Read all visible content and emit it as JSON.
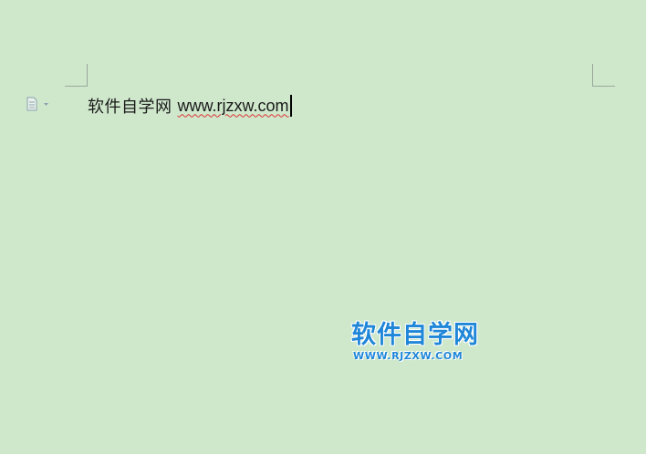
{
  "document": {
    "line_cn": "软件自学网",
    "line_url": "www.rjzxw.com"
  },
  "watermark": {
    "title": "软件自学网",
    "url": "WWW.RJZXW.COM",
    "color": "#1f86d8"
  },
  "colors": {
    "background": "#cfe8cc",
    "spellcheck_underline": "#e03030"
  },
  "icons": {
    "paragraph_handle": "paragraph-handle-icon"
  }
}
